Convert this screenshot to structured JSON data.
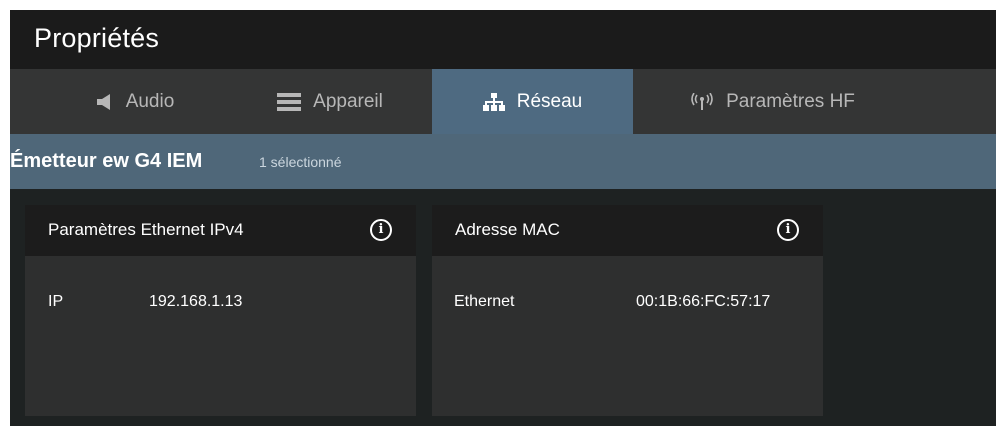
{
  "window": {
    "title": "Propriétés"
  },
  "tabs": [
    {
      "label": "Audio",
      "icon": "speaker-icon",
      "active": false
    },
    {
      "label": "Appareil",
      "icon": "device-icon",
      "active": false
    },
    {
      "label": "Réseau",
      "icon": "network-icon",
      "active": true
    },
    {
      "label": "Paramètres HF",
      "icon": "antenna-icon",
      "active": false
    }
  ],
  "subheader": {
    "device_name": "Émetteur ew G4 IEM",
    "selection": "1 sélectionné"
  },
  "cards": {
    "ethernet_ipv4": {
      "title": "Paramètres Ethernet IPv4",
      "rows": [
        {
          "label": "IP",
          "value": "192.168.1.13"
        }
      ]
    },
    "mac_address": {
      "title": "Adresse MAC",
      "rows": [
        {
          "label": "Ethernet",
          "value": "00:1B:66:FC:57:17"
        }
      ]
    }
  },
  "info_icon_glyph": "i",
  "colors": {
    "titlebar_bg": "#1b1b1b",
    "tabbar_bg": "#343535",
    "active_tab_bg": "#4e6a81",
    "subheader_bg": "#4f6779",
    "content_bg": "#1e2222",
    "card_bg": "#2e2f2f",
    "card_header_bg": "#1c1c1c"
  }
}
